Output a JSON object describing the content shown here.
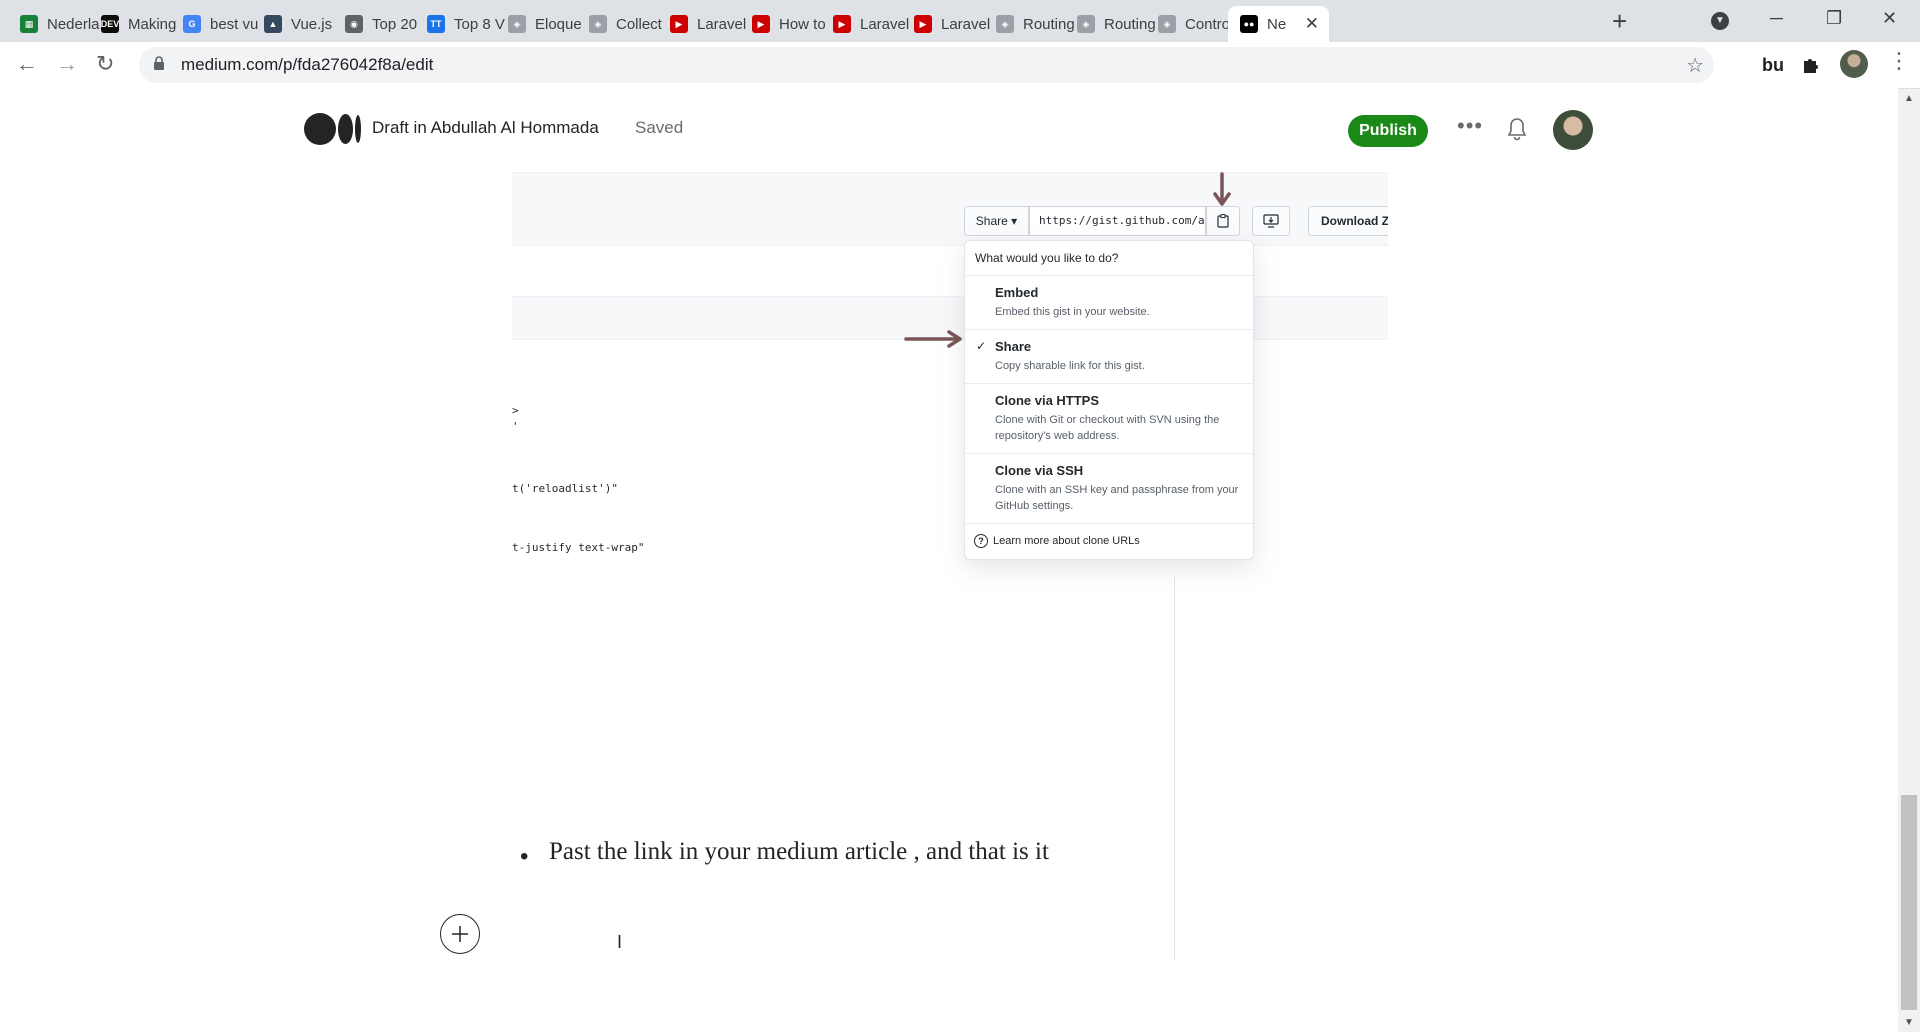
{
  "browser": {
    "tabs": [
      {
        "title": "Nederla",
        "icon": "sheets-icon",
        "color": "#188038"
      },
      {
        "title": "Making",
        "icon": "dev-icon",
        "color": "#0a0a0a"
      },
      {
        "title": "best vu",
        "icon": "google-icon",
        "color": "#4285f4"
      },
      {
        "title": "Vue.js",
        "icon": "vuejs-icon",
        "color": "#35495e"
      },
      {
        "title": "Top 20",
        "icon": "rss-icon",
        "color": "#5f6368"
      },
      {
        "title": "Top 8 V",
        "icon": "tt-icon",
        "color": "#1a73e8"
      },
      {
        "title": "Eloque",
        "icon": "laravel-icon",
        "color": "#9aa0a6"
      },
      {
        "title": "Collect",
        "icon": "laravel-icon",
        "color": "#9aa0a6"
      },
      {
        "title": "Laravel",
        "icon": "youtube-icon",
        "color": "#cc0000"
      },
      {
        "title": "How to",
        "icon": "youtube-icon",
        "color": "#cc0000"
      },
      {
        "title": "Laravel",
        "icon": "youtube-icon",
        "color": "#cc0000"
      },
      {
        "title": "Laravel",
        "icon": "youtube-icon",
        "color": "#cc0000"
      },
      {
        "title": "Routing",
        "icon": "laravel-icon",
        "color": "#9aa0a6"
      },
      {
        "title": "Routing",
        "icon": "laravel-icon",
        "color": "#9aa0a6"
      },
      {
        "title": "Contro",
        "icon": "laravel-icon",
        "color": "#9aa0a6"
      },
      {
        "title": "Ne",
        "icon": "medium-icon",
        "color": "#000000",
        "active": true
      }
    ],
    "url": "medium.com/p/fda276042f8a/edit",
    "extension_label": "bu"
  },
  "header": {
    "draft_label": "Draft in Abdullah Al Hommada",
    "saved_label": "Saved",
    "publish_label": "Publish",
    "accent_color": "#1a8917"
  },
  "gist": {
    "share_label": "Share ▾",
    "url_text": "https://gist.github.com/a",
    "download_label": "Download Z",
    "code_lines": [
      ">",
      "'",
      "t('reloadlist')\"",
      "t-justify text-wrap\""
    ],
    "dropdown": {
      "header": "What would you like to do?",
      "items": [
        {
          "title": "Embed",
          "desc": "Embed this gist in your website.",
          "checked": false
        },
        {
          "title": "Share",
          "desc": "Copy sharable link for this gist.",
          "checked": true
        },
        {
          "title": "Clone via HTTPS",
          "desc": "Clone with Git or checkout with SVN using the repository's web address.",
          "checked": false
        },
        {
          "title": "Clone via SSH",
          "desc": "Clone with an SSH key and passphrase from your GitHub settings.",
          "checked": false
        }
      ],
      "footer": "Learn more about clone URLs"
    },
    "arrow_color": "#7a5556"
  },
  "article": {
    "bullet_text": "Past the link in your medium article , and that is it"
  }
}
